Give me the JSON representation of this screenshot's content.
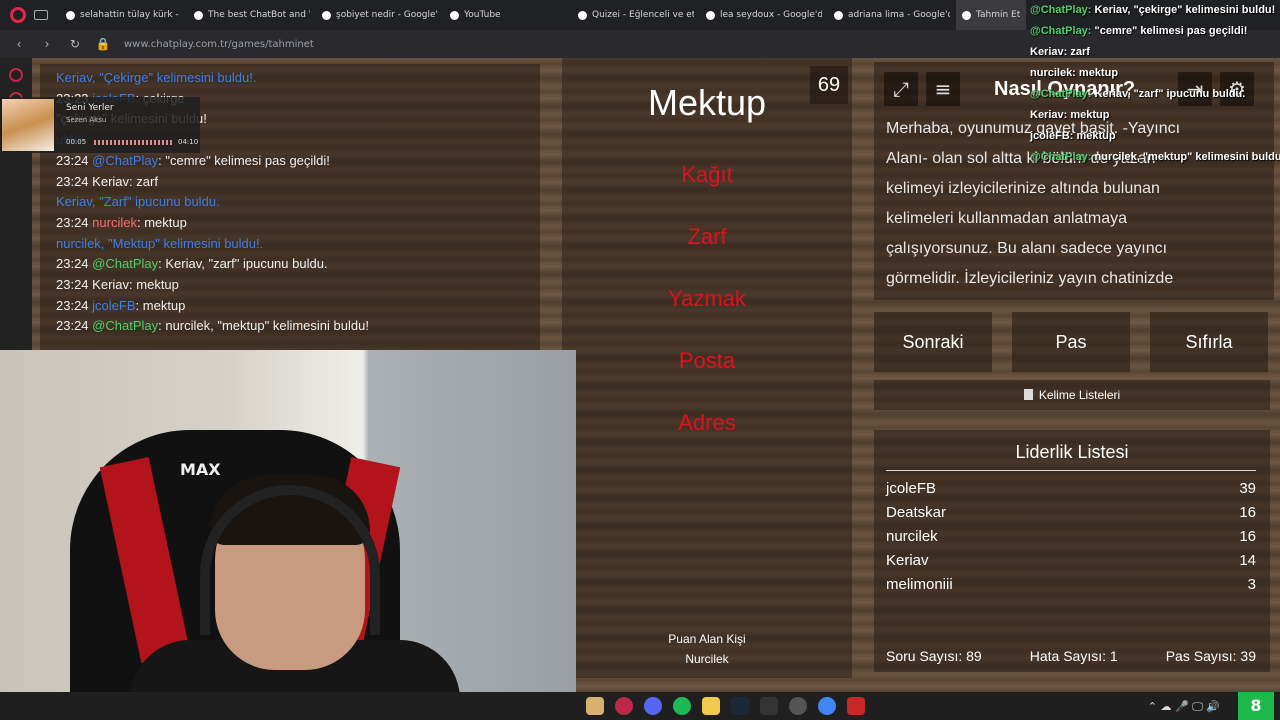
{
  "browser": {
    "tabs": [
      {
        "label": "selahattin tülay kürk - Goo",
        "active": false
      },
      {
        "label": "The best ChatBot and Wid",
        "active": false
      },
      {
        "label": "şobiyet nedir - Google'da",
        "active": false
      },
      {
        "label": "YouTube",
        "active": false
      },
      {
        "label": "Quizei - Eğlenceli ve etkil",
        "active": false
      },
      {
        "label": "lea seydoux - Google'da A",
        "active": false
      },
      {
        "label": "adriana lima - Google'da A",
        "active": false
      },
      {
        "label": "Tahmin Et -",
        "active": true
      }
    ],
    "url": "www.chatplay.com.tr/games/tahminet"
  },
  "music_widget": {
    "title": "Seni Yerler",
    "artist": "Sezen Aksu",
    "elapsed": "00:05",
    "duration": "04:10"
  },
  "chat_log": [
    {
      "time": "",
      "user": "Keriav,",
      "user_color": "blue",
      "text": " \"Çekirge\" kelimesini buldu!.",
      "text_color": "blue"
    },
    {
      "time": "23:23",
      "user": "jcoleFB",
      "user_color": "blue",
      "text": ": çekirge",
      "text_color": "white"
    },
    {
      "time": "",
      "user": "",
      "user_color": "white",
      "text": "\"çekirge\" kelimesini buldu!",
      "text_color": "white"
    },
    {
      "time": "",
      "user": "",
      "user_color": "blue",
      "text": "uldu!",
      "text_color": "blue"
    },
    {
      "time": "23:24",
      "user": "@ChatPlay",
      "user_color": "blue",
      "text": ": \"cemre\" kelimesi pas geçildi!",
      "text_color": "white"
    },
    {
      "time": "23:24",
      "user": "Keriav",
      "user_color": "white",
      "text": ": zarf",
      "text_color": "white"
    },
    {
      "time": "",
      "user": "Keriav,",
      "user_color": "blue",
      "text": " \"Zarf\" ipucunu buldu.",
      "text_color": "blue"
    },
    {
      "time": "23:24",
      "user": "nurcilek",
      "user_color": "red",
      "text": ": mektup",
      "text_color": "white"
    },
    {
      "time": "",
      "user": "nurcilek,",
      "user_color": "blue",
      "text": " \"Mektup\" kelimesini buldu!.",
      "text_color": "blue"
    },
    {
      "time": "23:24",
      "user": "@ChatPlay",
      "user_color": "green",
      "text": ": Keriav, \"zarf\" ipucunu buldu.",
      "text_color": "white"
    },
    {
      "time": "23:24",
      "user": "Keriav",
      "user_color": "white",
      "text": ": mektup",
      "text_color": "white"
    },
    {
      "time": "23:24",
      "user": "jcoleFB",
      "user_color": "blue",
      "text": ": mektup",
      "text_color": "white"
    },
    {
      "time": "23:24",
      "user": "@ChatPlay",
      "user_color": "green",
      "text": ": nurcilek, \"mektup\" kelimesini buldu!",
      "text_color": "white"
    }
  ],
  "game": {
    "word": "Mektup",
    "timer": "69",
    "forbidden_words": [
      "Kağıt",
      "Zarf",
      "Yazmak",
      "Posta",
      "Adres"
    ],
    "scorer_label": "Puan Alan Kişi",
    "scorer_name": "Nurcilek"
  },
  "howto": {
    "title": "Nasıl Oynanır?",
    "text": "Merhaba, oyunumuz gayet basit. -Yayıncı Alanı- olan sol altta ki bölüm de yazan kelimeyi izleyicilerinize altında bulunan kelimeleri kullanmadan anlatmaya çalışıyorsunuz. Bu alanı sadece yayıncı görmelidir. İzleyicileriniz yayın chatinizde"
  },
  "actions": {
    "next": "Sonraki",
    "pass": "Pas",
    "reset": "Sıfırla",
    "word_lists": "Kelime Listeleri"
  },
  "leaderboard": {
    "title": "Liderlik Listesi",
    "rows": [
      {
        "name": "jcoleFB",
        "score": "39"
      },
      {
        "name": "Deatskar",
        "score": "16"
      },
      {
        "name": "nurcilek",
        "score": "16"
      },
      {
        "name": "Keriav",
        "score": "14"
      },
      {
        "name": "melimoniii",
        "score": "3"
      }
    ],
    "question_count": "Soru Sayısı: 89",
    "error_count": "Hata Sayısı: 1",
    "pass_count": "Pas Sayısı: 39"
  },
  "overlay_chat": [
    {
      "user": "@ChatPlay:",
      "text": " Keriav, \"çekirge\" kelimesini buldu!"
    },
    {
      "user": "@ChatPlay:",
      "text": " \"cemre\" kelimesi pas geçildi!"
    },
    {
      "user": "Keriav:",
      "text": " zarf"
    },
    {
      "user": "nurcilek:",
      "text": " mektup"
    },
    {
      "user": "@ChatPlay:",
      "text": " Keriav, \"zarf\" ipucunu buldu."
    },
    {
      "user": "Keriav:",
      "text": " mektup"
    },
    {
      "user": "jcoleFB:",
      "text": " mektup"
    },
    {
      "user": "@ChatPlay:",
      "text": " nurcilek, \"mektup\" kelimesini buldu!"
    }
  ],
  "webcam": {
    "chair_brand": "MAX"
  },
  "taskbar": {
    "corner": "8"
  },
  "colors": {
    "forbidden": "#e0111f",
    "chat_blue": "#3f7fe8",
    "chat_green": "#4fcf6a",
    "chat_red": "#ff6a6a"
  }
}
